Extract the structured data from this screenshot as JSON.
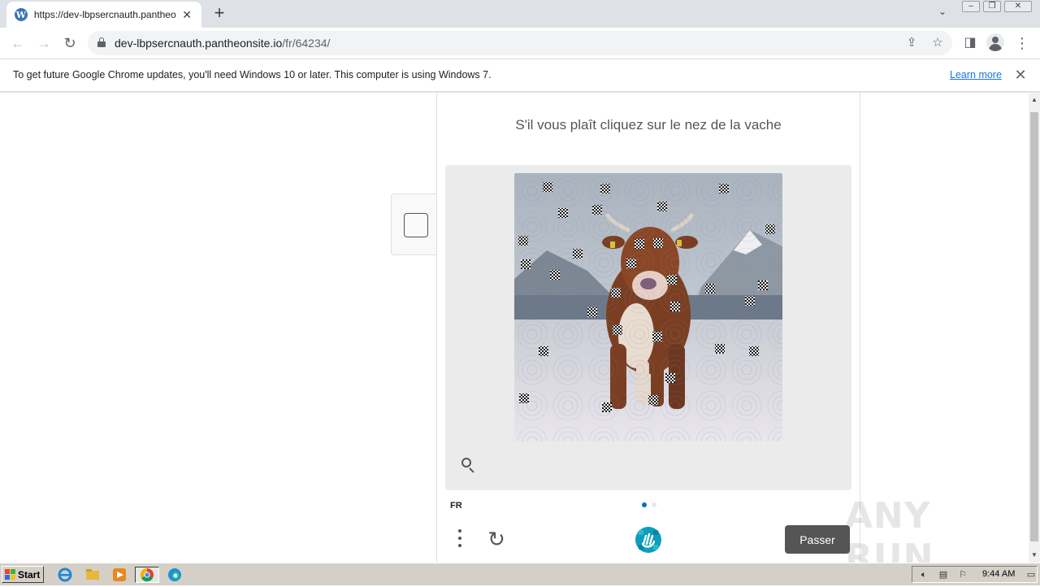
{
  "browser": {
    "tab": {
      "title": "https://dev-lbpsercnauth.pantheonsite.io/fr/64234/",
      "favicon": "wordpress-icon"
    },
    "url": {
      "host": "dev-lbpsercnauth.pantheonsite.io",
      "path": "/fr/64234/"
    }
  },
  "infobar": {
    "message": "To get future Google Chrome updates, you'll need Windows 10 or later. This computer is using Windows 7.",
    "link": "Learn more"
  },
  "challenge": {
    "prompt": "S'il vous plaît cliquez sur le nez de la vache",
    "language": "FR",
    "skip_label": "Passer",
    "page_count": 2,
    "current_page": 1
  },
  "taskbar": {
    "start_label": "Start",
    "clock": "9:44 AM"
  },
  "watermark": "ANY RUN",
  "colors": {
    "accent": "#0074bf",
    "skip_button": "#555555",
    "link": "#1a73e8"
  }
}
